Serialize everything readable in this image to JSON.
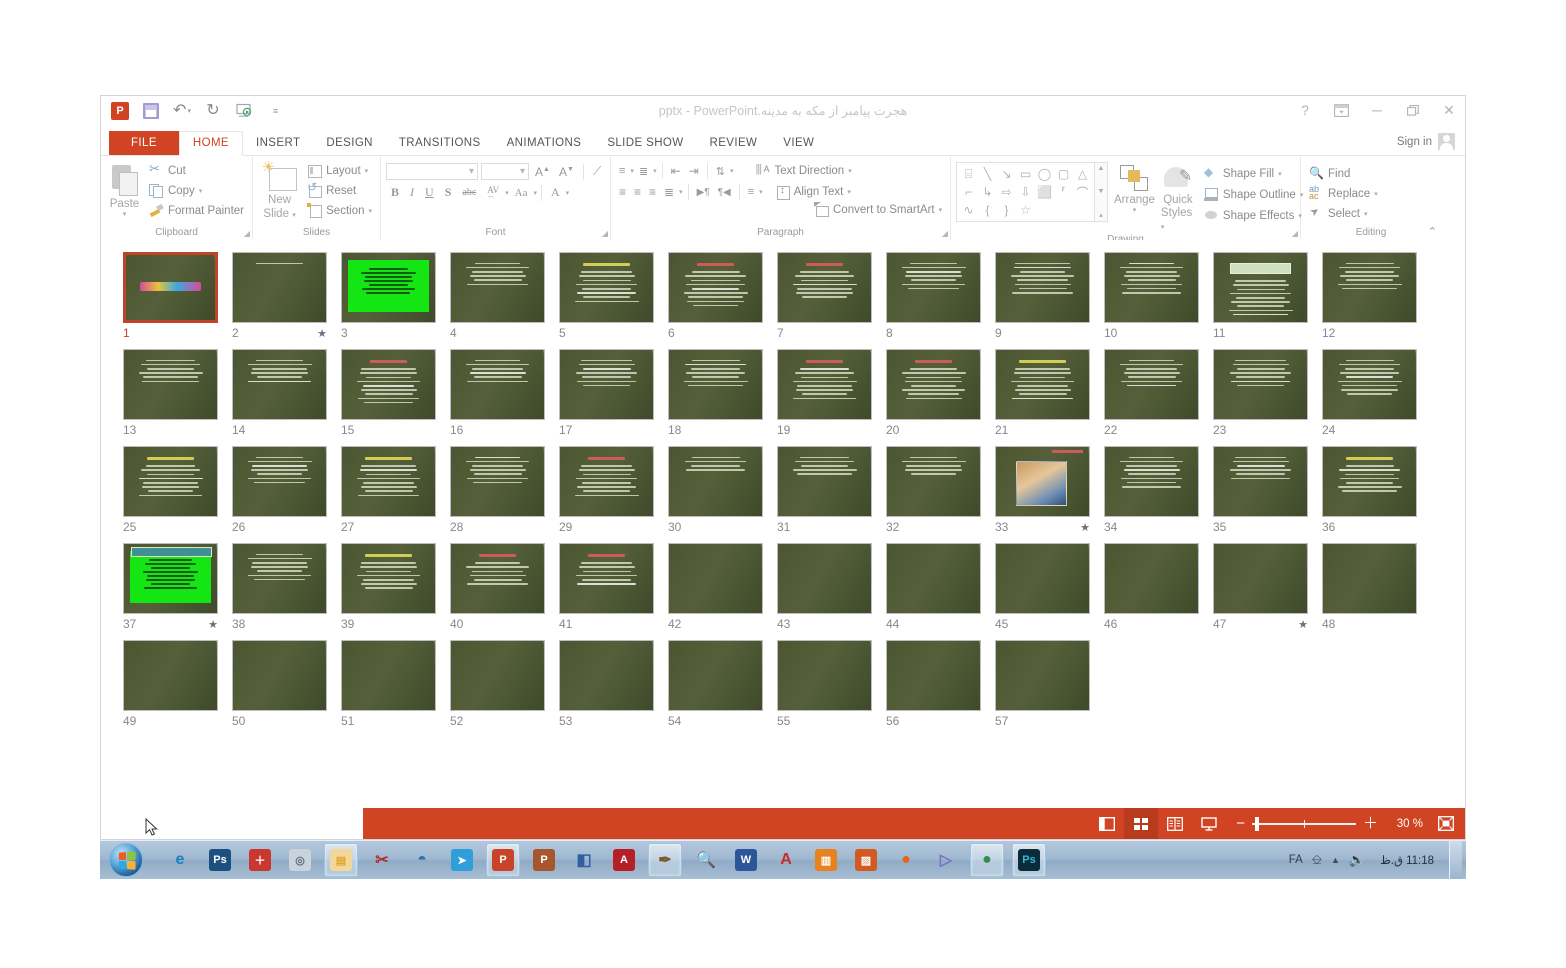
{
  "window": {
    "title": "هجرت پیامبر از مکه به مدینه.pptx - PowerPoint",
    "help_icon": "?",
    "ribbon_display_icon": "ribbon-display-options-icon",
    "minimize_icon": "─",
    "restore_icon": "❐",
    "close_icon": "✕",
    "signin_label": "Sign in"
  },
  "qat": {
    "app_logo": "P",
    "save_icon": "save-icon",
    "undo_icon": "↶",
    "redo_icon": "↻",
    "present_icon": "start-presentation-icon",
    "customize_icon": "≡"
  },
  "tabs": [
    {
      "label": "FILE",
      "kind": "file"
    },
    {
      "label": "HOME",
      "kind": "active"
    },
    {
      "label": "INSERT",
      "kind": "normal"
    },
    {
      "label": "DESIGN",
      "kind": "normal"
    },
    {
      "label": "TRANSITIONS",
      "kind": "normal"
    },
    {
      "label": "ANIMATIONS",
      "kind": "normal"
    },
    {
      "label": "SLIDE SHOW",
      "kind": "normal"
    },
    {
      "label": "REVIEW",
      "kind": "normal"
    },
    {
      "label": "VIEW",
      "kind": "normal"
    }
  ],
  "ribbon": {
    "clipboard": {
      "group_label": "Clipboard",
      "paste": "Paste",
      "cut": "Cut",
      "copy": "Copy",
      "format_painter": "Format Painter"
    },
    "slides": {
      "group_label": "Slides",
      "new_slide": "New\nSlide",
      "new_slide_line1": "New",
      "new_slide_line2": "Slide",
      "layout": "Layout",
      "reset": "Reset",
      "section": "Section"
    },
    "font": {
      "group_label": "Font",
      "font_name_value": "",
      "font_size_value": "",
      "grow_font": "A",
      "shrink_font": "A",
      "clear_formatting": "clear-formatting-icon",
      "bold": "B",
      "italic": "I",
      "underline": "U",
      "shadow": "S",
      "strikethrough": "abc",
      "character_spacing": "AV",
      "change_case": "Aa",
      "font_color": "A"
    },
    "paragraph": {
      "group_label": "Paragraph",
      "bullets": "bullets-icon",
      "numbering": "numbering-icon",
      "decrease_indent": "decrease-indent-icon",
      "increase_indent": "increase-indent-icon",
      "line_spacing": "line-spacing-icon",
      "align_left": "align-left-icon",
      "align_center": "align-center-icon",
      "align_right": "align-right-icon",
      "justify": "justify-icon",
      "ltr": "▶¶",
      "rtl": "¶◀",
      "columns": "columns-icon",
      "text_direction": "Text Direction",
      "align_text": "Align Text",
      "convert_to_smartart": "Convert to SmartArt"
    },
    "drawing": {
      "group_label": "Drawing",
      "arrange": "Arrange",
      "quick_styles_line1": "Quick",
      "quick_styles_line2": "Styles",
      "shape_fill": "Shape Fill",
      "shape_outline": "Shape Outline",
      "shape_effects": "Shape Effects",
      "shapes": [
        "⌸",
        "╲",
        "↘",
        "▭",
        "◯",
        "▢",
        "△",
        "⌐",
        "↳",
        "⇨",
        "⇩",
        "⬜",
        "⸢",
        "⌒",
        "∿",
        "{",
        "}",
        "☆"
      ]
    },
    "editing": {
      "group_label": "Editing",
      "find": "Find",
      "replace": "Replace",
      "select": "Select",
      "collapse_ribbon": "⌃"
    }
  },
  "slides": [
    {
      "n": "1",
      "type": "title",
      "star": false,
      "selected": true,
      "lines": 0
    },
    {
      "n": "2",
      "type": "oneline",
      "star": true,
      "selected": false,
      "lines": 1
    },
    {
      "n": "3",
      "type": "green",
      "star": false,
      "selected": false,
      "lines": 7
    },
    {
      "n": "4",
      "type": "text",
      "star": false,
      "selected": false,
      "lines": 6
    },
    {
      "n": "5",
      "type": "text-y",
      "star": false,
      "selected": false,
      "lines": 8
    },
    {
      "n": "6",
      "type": "text-r",
      "star": false,
      "selected": false,
      "lines": 9
    },
    {
      "n": "7",
      "type": "text-r",
      "star": false,
      "selected": false,
      "lines": 7
    },
    {
      "n": "8",
      "type": "text",
      "star": false,
      "selected": false,
      "lines": 7
    },
    {
      "n": "9",
      "type": "text",
      "star": false,
      "selected": false,
      "lines": 8
    },
    {
      "n": "10",
      "type": "text",
      "star": false,
      "selected": false,
      "lines": 8
    },
    {
      "n": "11",
      "type": "banner",
      "star": false,
      "selected": false,
      "lines": 9
    },
    {
      "n": "12",
      "type": "text",
      "star": false,
      "selected": false,
      "lines": 7
    },
    {
      "n": "13",
      "type": "text",
      "star": false,
      "selected": false,
      "lines": 6
    },
    {
      "n": "14",
      "type": "text",
      "star": false,
      "selected": false,
      "lines": 6
    },
    {
      "n": "15",
      "type": "text-r",
      "star": false,
      "selected": false,
      "lines": 9
    },
    {
      "n": "16",
      "type": "text",
      "star": false,
      "selected": false,
      "lines": 6
    },
    {
      "n": "17",
      "type": "text",
      "star": false,
      "selected": false,
      "lines": 7
    },
    {
      "n": "18",
      "type": "text",
      "star": false,
      "selected": false,
      "lines": 7
    },
    {
      "n": "19",
      "type": "text-r",
      "star": false,
      "selected": false,
      "lines": 8
    },
    {
      "n": "20",
      "type": "text-r",
      "star": false,
      "selected": false,
      "lines": 8
    },
    {
      "n": "21",
      "type": "text-y",
      "star": false,
      "selected": false,
      "lines": 8
    },
    {
      "n": "22",
      "type": "text",
      "star": false,
      "selected": false,
      "lines": 7
    },
    {
      "n": "23",
      "type": "text",
      "star": false,
      "selected": false,
      "lines": 7
    },
    {
      "n": "24",
      "type": "text",
      "star": false,
      "selected": false,
      "lines": 9
    },
    {
      "n": "25",
      "type": "text-y",
      "star": false,
      "selected": false,
      "lines": 8
    },
    {
      "n": "26",
      "type": "text",
      "star": false,
      "selected": false,
      "lines": 7
    },
    {
      "n": "27",
      "type": "text-y",
      "star": false,
      "selected": false,
      "lines": 8
    },
    {
      "n": "28",
      "type": "text",
      "star": false,
      "selected": false,
      "lines": 7
    },
    {
      "n": "29",
      "type": "text-r",
      "star": false,
      "selected": false,
      "lines": 8
    },
    {
      "n": "30",
      "type": "text",
      "star": false,
      "selected": false,
      "lines": 4
    },
    {
      "n": "31",
      "type": "text",
      "star": false,
      "selected": false,
      "lines": 5
    },
    {
      "n": "32",
      "type": "text",
      "star": false,
      "selected": false,
      "lines": 5
    },
    {
      "n": "33",
      "type": "image",
      "star": true,
      "selected": false,
      "lines": 0
    },
    {
      "n": "34",
      "type": "text",
      "star": false,
      "selected": false,
      "lines": 8
    },
    {
      "n": "35",
      "type": "text",
      "star": false,
      "selected": false,
      "lines": 6
    },
    {
      "n": "36",
      "type": "text-y",
      "star": false,
      "selected": false,
      "lines": 7
    },
    {
      "n": "37",
      "type": "green-t",
      "star": true,
      "selected": false,
      "lines": 8
    },
    {
      "n": "38",
      "type": "text",
      "star": false,
      "selected": false,
      "lines": 7
    },
    {
      "n": "39",
      "type": "text-y",
      "star": false,
      "selected": false,
      "lines": 7
    },
    {
      "n": "40",
      "type": "text-r",
      "star": false,
      "selected": false,
      "lines": 6
    },
    {
      "n": "41",
      "type": "text-r",
      "star": false,
      "selected": false,
      "lines": 6
    },
    {
      "n": "42",
      "type": "blank",
      "star": false,
      "selected": false,
      "lines": 0
    },
    {
      "n": "43",
      "type": "blank",
      "star": false,
      "selected": false,
      "lines": 0
    },
    {
      "n": "44",
      "type": "blank",
      "star": false,
      "selected": false,
      "lines": 0
    },
    {
      "n": "45",
      "type": "blank",
      "star": false,
      "selected": false,
      "lines": 0
    },
    {
      "n": "46",
      "type": "blank",
      "star": false,
      "selected": false,
      "lines": 0
    },
    {
      "n": "47",
      "type": "blank",
      "star": true,
      "selected": false,
      "lines": 0
    },
    {
      "n": "48",
      "type": "blank",
      "star": false,
      "selected": false,
      "lines": 0
    },
    {
      "n": "49",
      "type": "blank",
      "star": false,
      "selected": false,
      "lines": 0
    },
    {
      "n": "50",
      "type": "blank",
      "star": false,
      "selected": false,
      "lines": 0
    },
    {
      "n": "51",
      "type": "blank",
      "star": false,
      "selected": false,
      "lines": 0
    },
    {
      "n": "52",
      "type": "blank",
      "star": false,
      "selected": false,
      "lines": 0
    },
    {
      "n": "53",
      "type": "blank",
      "star": false,
      "selected": false,
      "lines": 0
    },
    {
      "n": "54",
      "type": "blank",
      "star": false,
      "selected": false,
      "lines": 0
    },
    {
      "n": "55",
      "type": "blank",
      "star": false,
      "selected": false,
      "lines": 0
    },
    {
      "n": "56",
      "type": "blank",
      "star": false,
      "selected": false,
      "lines": 0
    },
    {
      "n": "57",
      "type": "blank",
      "star": false,
      "selected": false,
      "lines": 0
    }
  ],
  "statusbar": {
    "view_normal": "normal-view-icon",
    "view_sorter": "slide-sorter-view-icon",
    "view_reading": "reading-view-icon",
    "view_slideshow": "slideshow-view-icon",
    "zoom_out": "−",
    "zoom_in": "＋",
    "zoom_label": "30 %",
    "fit_to_window": "fit-slide-icon"
  },
  "taskbar": {
    "start": "start-orb",
    "items": [
      {
        "name": "internet-explorer",
        "glyph": "e",
        "color": "#1a7fc1",
        "bg": "transparent",
        "active": false
      },
      {
        "name": "photoshop",
        "glyph": "Ps",
        "color": "#ffffff",
        "bg": "#1d4f80",
        "active": false
      },
      {
        "name": "pdf-tool",
        "glyph": "＋",
        "color": "#ffffff",
        "bg": "#c8382e",
        "active": false
      },
      {
        "name": "camera-tool",
        "glyph": "◎",
        "color": "#5d6b78",
        "bg": "#c9d3dc",
        "active": false
      },
      {
        "name": "file-explorer",
        "glyph": "▤",
        "color": "#e0a528",
        "bg": "#f2d79a",
        "active": true
      },
      {
        "name": "snipping-tool",
        "glyph": "✂",
        "color": "#b03030",
        "bg": "transparent",
        "active": false
      },
      {
        "name": "network-app",
        "glyph": "◓",
        "color": "#2f6fa8",
        "bg": "transparent",
        "active": false
      },
      {
        "name": "telegram",
        "glyph": "➤",
        "color": "#ffffff",
        "bg": "#2f9fd9",
        "active": false
      },
      {
        "name": "powerpoint",
        "glyph": "P",
        "color": "#ffffff",
        "bg": "#c8432a",
        "active": true
      },
      {
        "name": "powerpoint-viewer",
        "glyph": "P",
        "color": "#ffffff",
        "bg": "#a8562e",
        "active": false
      },
      {
        "name": "chart-app",
        "glyph": "◧",
        "color": "#2f5f9f",
        "bg": "transparent",
        "active": false
      },
      {
        "name": "adobe-reader",
        "glyph": "A",
        "color": "#ffffff",
        "bg": "#b42025",
        "active": false
      },
      {
        "name": "pen-tool",
        "glyph": "✒",
        "color": "#7a5a2a",
        "bg": "transparent",
        "active": true
      },
      {
        "name": "search-tool",
        "glyph": "🔍",
        "color": "#e08a1e",
        "bg": "transparent",
        "active": false
      },
      {
        "name": "word",
        "glyph": "W",
        "color": "#ffffff",
        "bg": "#2b579a",
        "active": false
      },
      {
        "name": "font-app",
        "glyph": "A",
        "color": "#cc2b2b",
        "bg": "transparent",
        "active": false
      },
      {
        "name": "pdf-creator",
        "glyph": "▥",
        "color": "#ffffff",
        "bg": "#e8821e",
        "active": false
      },
      {
        "name": "winrar",
        "glyph": "▨",
        "color": "#ffffff",
        "bg": "#d25a1e",
        "active": false
      },
      {
        "name": "firefox",
        "glyph": "●",
        "color": "#e8641c",
        "bg": "transparent",
        "active": false
      },
      {
        "name": "media-player",
        "glyph": "▷",
        "color": "#7a6fc0",
        "bg": "transparent",
        "active": false
      },
      {
        "name": "chrome",
        "glyph": "●",
        "color": "#2f8f4f",
        "bg": "transparent",
        "active": true
      },
      {
        "name": "photoshop-open",
        "glyph": "Ps",
        "color": "#30b8e0",
        "bg": "#0b2a3a",
        "active": true
      }
    ],
    "tray": {
      "language": "FA",
      "keyboard_icon": "keyboard-icon",
      "show_hidden_icon": "▲",
      "volume_icon": "🔊",
      "clock": "11:18 ق.ظ",
      "show_desktop": "show-desktop-button"
    }
  }
}
